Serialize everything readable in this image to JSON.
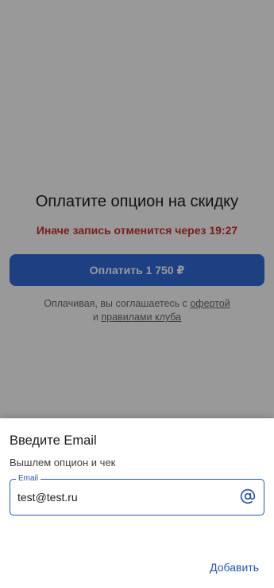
{
  "payment": {
    "title": "Оплатите опцион на скидку",
    "timer_text": "Иначе запись отменится через 19:27",
    "pay_button_label": "Оплатить 1 750 ₽",
    "terms": {
      "prefix": "Оплачивая, вы соглашаетесь с ",
      "offer_link": "офертой",
      "and": "и ",
      "rules_link": "правилами клуба"
    }
  },
  "sheet": {
    "title": "Введите Email",
    "subtitle": "Вышлем опцион и чек",
    "email_field": {
      "label": "Email",
      "value": "test@test.ru"
    },
    "add_button_label": "Добавить"
  },
  "colors": {
    "primary": "#2256b7",
    "pay_button": "#2f6bd8",
    "timer": "#d0312d",
    "overlay": "rgba(0,0,0,0.4)"
  },
  "icons": {
    "email_field_icon": "at-sign-icon"
  }
}
